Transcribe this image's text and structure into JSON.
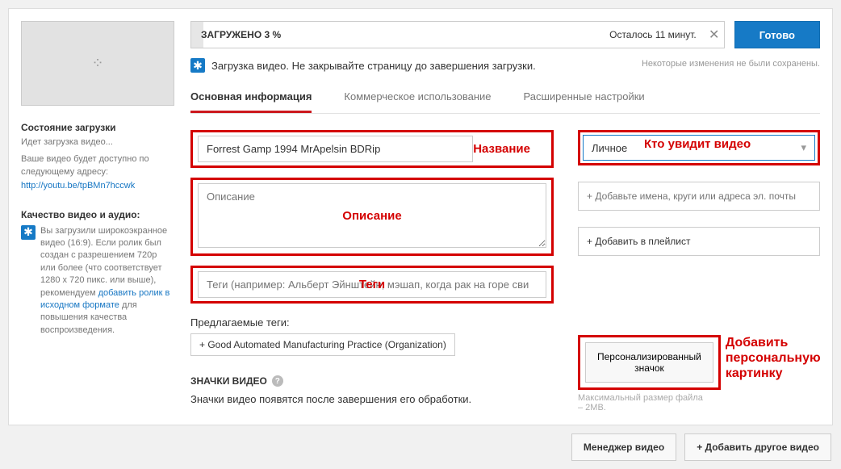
{
  "top": {
    "progress_label": "ЗАГРУЖЕНО 3 %",
    "progress_percent": 3,
    "time_left": "Осталось 11 минут.",
    "done": "Готово"
  },
  "upload_msg": "Загрузка видео. Не закрывайте страницу до завершения загрузки.",
  "save_note": "Некоторые изменения не были сохранены.",
  "tabs": {
    "basic": "Основная информация",
    "monetize": "Коммерческое использование",
    "advanced": "Расширенные настройки"
  },
  "left": {
    "status_title": "Состояние загрузки",
    "status_text": "Идет загрузка видео...",
    "avail_text": "Ваше видео будет доступно по следующему адресу:",
    "url": "http://youtu.be/tpBMn7hccwk",
    "quality_title": "Качество видео и аудио:",
    "quality_text1": "Вы загрузили широкоэкранное видео (16:9). Если ролик был создан с разрешением 720p или более (что соответствует 1280 x 720 пикс. или выше), рекомендуем ",
    "quality_link": "добавить ролик в исходном формате",
    "quality_text2": " для повышения качества воспроизведения."
  },
  "form": {
    "title_value": "Forrest Gamp 1994 MrApelsin BDRip",
    "desc_placeholder": "Описание",
    "tags_placeholder": "Теги (например: Альберт Эйнштейн, мэшап, когда рак на горе сви",
    "privacy_value": "Личное",
    "share_placeholder": "+ Добавьте имена, круги или адреса эл. почты",
    "playlist_btn": "+ Добавить в плейлист",
    "suggested_label": "Предлагаемые теги:",
    "suggested_tag": "+ Good Automated Manufacturing Practice (Organization)",
    "thumbs_title": "ЗНАЧКИ ВИДЕО",
    "thumbs_note": "Значки видео появятся после завершения его обработки.",
    "custom_thumb_btn": "Персонализированный значок",
    "custom_thumb_note": "Максимальный размер файла – 2MB."
  },
  "annotations": {
    "title": "Название",
    "desc": "Описание",
    "tags": "Теги",
    "privacy": "Кто увидит видео",
    "thumb": "Добавить персональную картинку"
  },
  "bottom": {
    "manager": "Менеджер видео",
    "add_another": "+  Добавить другое видео"
  }
}
